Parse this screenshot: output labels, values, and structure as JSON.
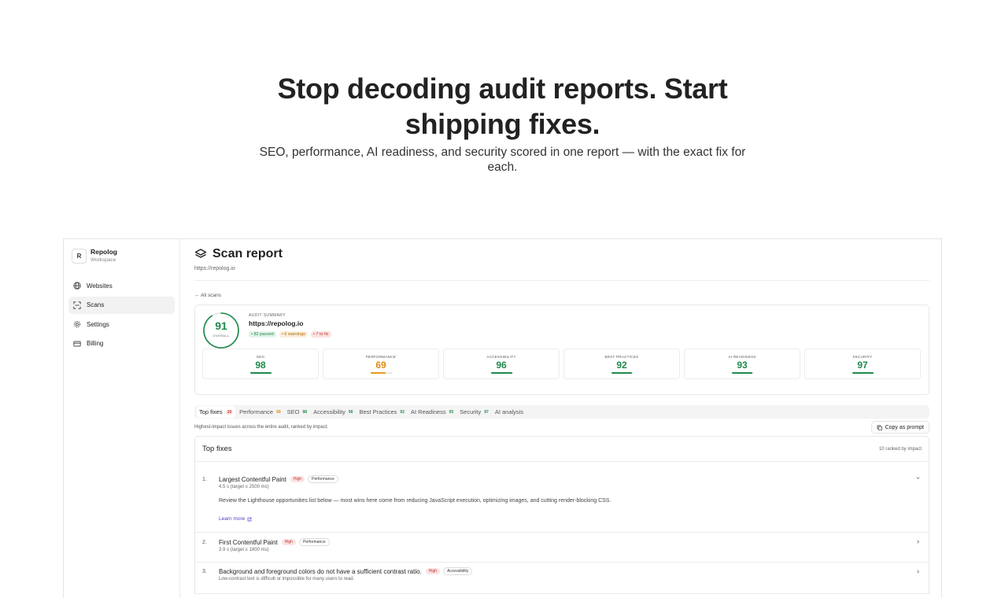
{
  "hero": {
    "title": "Stop decoding audit reports. Start shipping fixes.",
    "subtitle": "SEO, performance, AI readiness, and security scored in one report — with the exact fix for each."
  },
  "workspace": {
    "avatar": "R",
    "name": "Repolog",
    "sub": "Workspace"
  },
  "nav": [
    {
      "label": "Websites",
      "icon": "globe-icon",
      "active": false
    },
    {
      "label": "Scans",
      "icon": "scan-icon",
      "active": true
    },
    {
      "label": "Settings",
      "icon": "gear-icon",
      "active": false
    },
    {
      "label": "Billing",
      "icon": "credit-card-icon",
      "active": false
    }
  ],
  "report": {
    "title": "Scan report",
    "url": "https://repolog.io",
    "back": "← All scans",
    "summary": {
      "overall": "91",
      "overall_label": "OVERALL",
      "overall_value": 91,
      "kicker": "AUDIT SUMMARY",
      "url": "https://repolog.io",
      "passed": "• 82 passed",
      "warnings": "• 6 warnings",
      "to_fix": "• 7 to fix"
    },
    "categories": [
      {
        "name": "SEO",
        "score": "98",
        "value": 98,
        "tone": "g"
      },
      {
        "name": "Performance",
        "score": "69",
        "value": 69,
        "tone": "o"
      },
      {
        "name": "Accessibility",
        "score": "96",
        "value": 96,
        "tone": "g"
      },
      {
        "name": "Best Practices",
        "score": "92",
        "value": 92,
        "tone": "g"
      },
      {
        "name": "AI Readiness",
        "score": "93",
        "value": 93,
        "tone": "g"
      },
      {
        "name": "Security",
        "score": "97",
        "value": 97,
        "tone": "g"
      }
    ],
    "tabs": [
      {
        "label": "Top fixes",
        "count": "10",
        "tone": "r",
        "active": true
      },
      {
        "label": "Performance",
        "count": "69",
        "tone": "o",
        "active": false
      },
      {
        "label": "SEO",
        "count": "98",
        "tone": "g",
        "active": false
      },
      {
        "label": "Accessibility",
        "count": "96",
        "tone": "g",
        "active": false
      },
      {
        "label": "Best Practices",
        "count": "92",
        "tone": "g",
        "active": false
      },
      {
        "label": "AI Readiness",
        "count": "93",
        "tone": "g",
        "active": false
      },
      {
        "label": "Security",
        "count": "97",
        "tone": "g",
        "active": false
      },
      {
        "label": "AI analysis",
        "count": "",
        "tone": "",
        "active": false
      }
    ],
    "tab_description": "Highest-impact issues across the entire audit, ranked by impact.",
    "copy_label": "Copy as prompt",
    "fixes_title": "Top fixes",
    "fixes_meta": "10 ranked by impact",
    "fixes": [
      {
        "index": "1.",
        "title": "Largest Contentful Paint",
        "severity": "High",
        "category": "Performance",
        "sub": "4.5 s (target ≤ 2500 ms)",
        "desc": "Review the Lighthouse opportunities list below — most wins here come from reducing JavaScript execution, optimizing images, and cutting render-blocking CSS.",
        "link": "Learn more"
      },
      {
        "index": "2.",
        "title": "First Contentful Paint",
        "severity": "High",
        "category": "Performance",
        "sub": "3.9 s (target ≤ 1800 ms)"
      },
      {
        "index": "3.",
        "title": "Background and foreground colors do not have a sufficient contrast ratio.",
        "severity": "High",
        "category": "Accessibility",
        "sub": "Low-contrast text is difficult or impossible for many users to read."
      }
    ]
  },
  "colors": {
    "good": "#1f8a4c",
    "warn": "#e08a10",
    "bad": "#c0392b",
    "link": "#4a3fc7"
  }
}
